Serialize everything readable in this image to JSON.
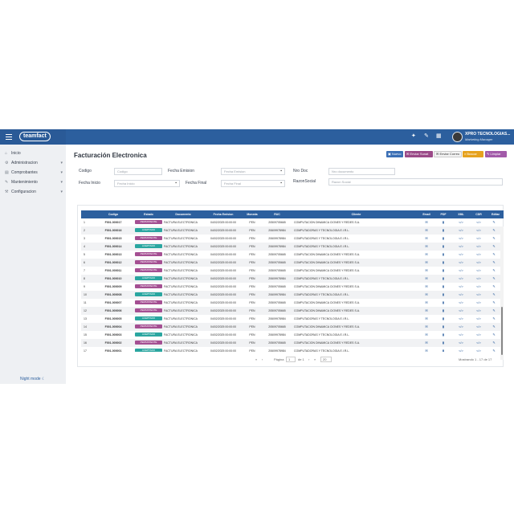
{
  "app": {
    "logo": "teamfact"
  },
  "header": {
    "company": "XPRO TECNOLOGIAS...",
    "role": "Marketing Manager"
  },
  "sidebar": {
    "items": [
      {
        "label": "Inicio",
        "icon": "home-icon"
      },
      {
        "label": "Administracion",
        "icon": "gear-icon"
      },
      {
        "label": "Comprobantes",
        "icon": "document-icon"
      },
      {
        "label": "Mantenimiento",
        "icon": "wrench-icon"
      },
      {
        "label": "Configuracion",
        "icon": "sliders-icon"
      }
    ],
    "night_mode": "Night mode"
  },
  "page": {
    "title": "Facturación Electronica"
  },
  "toolbar": {
    "nuevo": "Nuevo",
    "enviar_sunat": "Enviar Sunat",
    "enviar_correo": "Enviar Correo",
    "buscar": "Buscar",
    "limpiar": "Limpiar"
  },
  "filters": {
    "codigo_label": "Codigo",
    "codigo_placeholder": "Codigo",
    "fecha_inicio_label": "Fecha Inicio",
    "fecha_inicio_placeholder": "Fecha Inicio",
    "fecha_emision_label": "Fecha Emision",
    "fecha_emision_placeholder": "Fecha Emision",
    "fecha_final_label": "Fecha Final",
    "fecha_final_placeholder": "Fecha Final",
    "nro_doc_label": "Nro Doc",
    "nro_doc_placeholder": "Nro documento",
    "razon_social_label": "RazonSocial",
    "razon_social_placeholder": "Razon Social"
  },
  "table": {
    "columns": [
      "Codigo",
      "Estado",
      "Documento",
      "Fecha Emision",
      "Moneda",
      "RUC",
      "Cliente",
      "Email",
      "PDF",
      "XML",
      "CDR",
      "Editar"
    ],
    "rows": [
      [
        "1",
        "F001-000017",
        "PERSISTENTE",
        "FACTURA ELECTRONICA",
        "04/02/2025 00:00:00",
        "PEN",
        "20509705665",
        "COMPUTACION DINAMICA CIONES Y REDES S.A."
      ],
      [
        "2",
        "F001-000016",
        "ACEPTADO",
        "FACTURA ELECTRONICA",
        "04/02/2025 00:00:00",
        "PEN",
        "20609978984",
        "COMPUTADORAS Y TECNOLOGIA E.I.R.L."
      ],
      [
        "3",
        "F001-000015",
        "PERSISTENTE",
        "FACTURA ELECTRONICA",
        "04/02/2025 00:00:00",
        "PEN",
        "20609978984",
        "COMPUTADORAS Y TECNOLOGIA E.I.R.L."
      ],
      [
        "4",
        "F001-000014",
        "ACEPTADO",
        "FACTURA ELECTRONICA",
        "04/02/2025 00:00:00",
        "PEN",
        "20609978984",
        "COMPUTADORAS Y TECNOLOGIA E.I.R.L."
      ],
      [
        "5",
        "F001-000013",
        "PERSISTENTE",
        "FACTURA ELECTRONICA",
        "04/02/2025 00:00:00",
        "PEN",
        "20509705665",
        "COMPUTACION DINAMICA CIONES Y REDES S.A."
      ],
      [
        "6",
        "F001-000012",
        "PERSISTENTE",
        "FACTURA ELECTRONICA",
        "04/02/2025 00:00:00",
        "PEN",
        "20509705665",
        "COMPUTACION DINAMICA CIONES Y REDES S.A."
      ],
      [
        "7",
        "F001-000011",
        "PERSISTENTE",
        "FACTURA ELECTRONICA",
        "04/02/2025 00:00:00",
        "PEN",
        "20509705665",
        "COMPUTACION DINAMICA CIONES Y REDES S.A."
      ],
      [
        "8",
        "F001-000010",
        "ACEPTADO",
        "FACTURA ELECTRONICA",
        "04/02/2025 00:00:00",
        "PEN",
        "20609978984",
        "COMPUTADORAS Y TECNOLOGIA E.I.R.L."
      ],
      [
        "9",
        "F001-000009",
        "PERSISTENTE",
        "FACTURA ELECTRONICA",
        "04/02/2025 00:00:00",
        "PEN",
        "20509705665",
        "COMPUTACION DINAMICA CIONES Y REDES S.A."
      ],
      [
        "10",
        "F001-000008",
        "ACEPTADO",
        "FACTURA ELECTRONICA",
        "04/02/2025 00:00:00",
        "PEN",
        "20609978984",
        "COMPUTADORAS Y TECNOLOGIA E.I.R.L."
      ],
      [
        "11",
        "F001-000007",
        "PERSISTENTE",
        "FACTURA ELECTRONICA",
        "04/02/2025 00:00:00",
        "PEN",
        "20509705665",
        "COMPUTACION DINAMICA CIONES Y REDES S.A."
      ],
      [
        "12",
        "F001-000006",
        "PERSISTENTE",
        "FACTURA ELECTRONICA",
        "04/02/2025 00:00:00",
        "PEN",
        "20509705665",
        "COMPUTACION DINAMICA CIONES Y REDES S.A."
      ],
      [
        "13",
        "F001-000005",
        "ACEPTADO",
        "FACTURA ELECTRONICA",
        "04/02/2025 00:00:00",
        "PEN",
        "20609978984",
        "COMPUTADORAS Y TECNOLOGIA E.I.R.L."
      ],
      [
        "14",
        "F001-000004",
        "PERSISTENTE",
        "FACTURA ELECTRONICA",
        "04/02/2025 00:00:00",
        "PEN",
        "20509705665",
        "COMPUTACION DINAMICA CIONES Y REDES S.A."
      ],
      [
        "15",
        "F001-000003",
        "ACEPTADO",
        "FACTURA ELECTRONICA",
        "04/02/2025 00:00:00",
        "PEN",
        "20609978984",
        "COMPUTADORAS Y TECNOLOGIA E.I.R.L."
      ],
      [
        "16",
        "F001-000002",
        "PERSISTENTE",
        "FACTURA ELECTRONICA",
        "04/02/2025 00:00:00",
        "PEN",
        "20509705665",
        "COMPUTACION DINAMICA CIONES Y REDES S.A."
      ],
      [
        "17",
        "F001-000001",
        "ACEPTADO",
        "FACTURA ELECTRONICA",
        "04/02/2025 00:00:00",
        "PEN",
        "20609978984",
        "COMPUTADORAS Y TECNOLOGIA E.I.R.L."
      ]
    ]
  },
  "pagination": {
    "page_label": "Página",
    "page": "1",
    "of": "de 1",
    "page_size": "20",
    "records": "Mostrando 1 - 17 de 17"
  },
  "colors": {
    "header": "#2c5f9e",
    "persistente": "#a44f92",
    "aceptado": "#2aa6a0"
  }
}
